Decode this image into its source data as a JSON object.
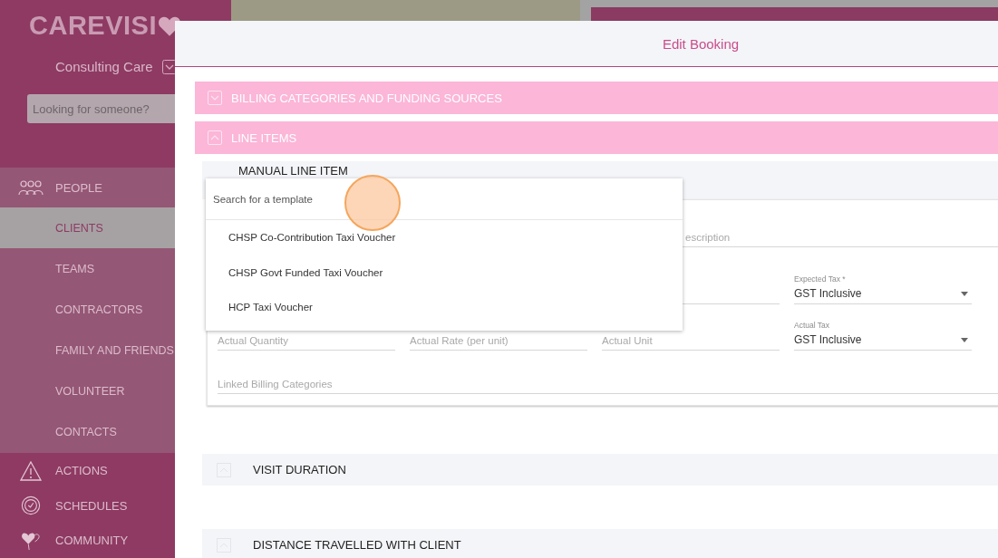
{
  "logo": {
    "text": "CAREVISI"
  },
  "organization": {
    "name": "Consulting Care"
  },
  "search": {
    "placeholder": "Looking for someone?"
  },
  "nav": [
    {
      "label": "PEOPLE",
      "selected": false,
      "children": [
        {
          "label": "CLIENTS",
          "selected": true
        },
        {
          "label": "TEAMS",
          "selected": false
        },
        {
          "label": "CONTRACTORS",
          "selected": false
        },
        {
          "label": "FAMILY AND FRIENDS",
          "selected": false
        },
        {
          "label": "VOLUNTEER",
          "selected": false
        },
        {
          "label": "CONTACTS",
          "selected": false
        }
      ]
    },
    {
      "label": "ACTIONS",
      "selected": false
    },
    {
      "label": "SCHEDULES",
      "selected": false
    },
    {
      "label": "COMMUNITY",
      "selected": false
    }
  ],
  "modal": {
    "title": "Edit Booking",
    "sections": [
      {
        "title": "BILLING CATEGORIES AND FUNDING SOURCES",
        "expanded": false
      },
      {
        "title": "LINE ITEMS",
        "expanded": true
      }
    ],
    "line_item": {
      "title": "MANUAL LINE ITEM",
      "rows": [
        [
          {
            "kind": "wide",
            "label": "escription"
          }
        ],
        [
          "",
          "",
          {
            "kind": "text"
          },
          {
            "kind": "select",
            "label": "Expected Tax *",
            "value": "GST Inclusive"
          }
        ],
        [
          {
            "kind": "text",
            "label": "Actual Quantity"
          },
          {
            "kind": "text",
            "label": "Actual Rate (per unit)"
          },
          {
            "kind": "text",
            "label": "Actual Unit"
          },
          {
            "kind": "select",
            "label": "Actual Tax",
            "value": "GST Inclusive"
          }
        ],
        [
          {
            "kind": "wide",
            "label": "Linked Billing Categories"
          }
        ]
      ]
    },
    "template_dropdown": {
      "placeholder": "Search for a template",
      "options": [
        "CHSP Co-Contribution Taxi Voucher",
        "CHSP Govt Funded Taxi Voucher",
        "HCP Taxi Voucher"
      ]
    },
    "subsections": [
      {
        "title": "VISIT DURATION"
      },
      {
        "title": "DISTANCE TRAVELLED WITH CLIENT"
      }
    ]
  }
}
